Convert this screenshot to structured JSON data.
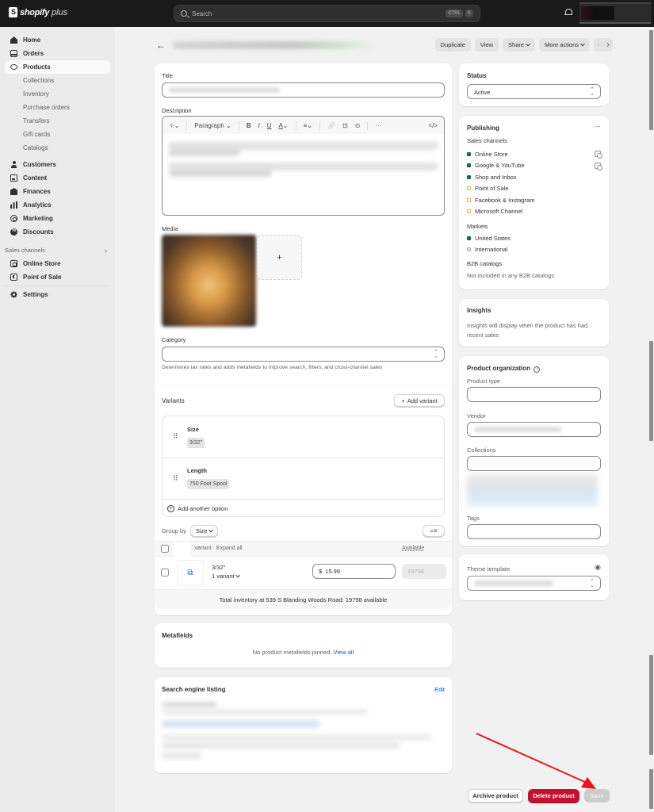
{
  "topbar": {
    "brand": "shopify",
    "brand_suffix": "plus",
    "search_placeholder": "Search",
    "shortcut_keys": [
      "CTRL",
      "K"
    ]
  },
  "sidebar": {
    "items": [
      {
        "label": "Home",
        "icon": "home-icon"
      },
      {
        "label": "Orders",
        "icon": "orders-icon"
      },
      {
        "label": "Products",
        "icon": "tag-icon",
        "active": true
      },
      {
        "label": "Collections",
        "sub": true
      },
      {
        "label": "Inventory",
        "sub": true
      },
      {
        "label": "Purchase orders",
        "sub": true
      },
      {
        "label": "Transfers",
        "sub": true
      },
      {
        "label": "Gift cards",
        "sub": true
      },
      {
        "label": "Catalogs",
        "sub": true
      },
      {
        "label": "Customers",
        "icon": "person-icon"
      },
      {
        "label": "Content",
        "icon": "content-icon"
      },
      {
        "label": "Finances",
        "icon": "bank-icon"
      },
      {
        "label": "Analytics",
        "icon": "chart-icon"
      },
      {
        "label": "Marketing",
        "icon": "marketing-icon"
      },
      {
        "label": "Discounts",
        "icon": "discount-icon"
      }
    ],
    "sales_channels_heading": "Sales channels",
    "channels": [
      {
        "label": "Online Store",
        "icon": "store-icon"
      },
      {
        "label": "Point of Sale",
        "icon": "pos-icon"
      }
    ],
    "settings_label": "Settings"
  },
  "header": {
    "buttons": {
      "duplicate": "Duplicate",
      "view": "View",
      "share": "Share",
      "more_actions": "More actions"
    }
  },
  "product": {
    "title_label": "Title",
    "description_label": "Description",
    "toolbar": {
      "format": "Paragraph"
    },
    "media_label": "Media",
    "category_label": "Category",
    "category_help": "Determines tax rates and adds metafields to improve search, filters, and cross-channel sales"
  },
  "variants": {
    "title": "Variants",
    "add_variant": "Add variant",
    "options": [
      {
        "name": "Size",
        "values": [
          "3/32\""
        ]
      },
      {
        "name": "Length",
        "values": [
          "750 Foot Spool"
        ]
      }
    ],
    "add_option": "Add another option",
    "group_by_label": "Group by",
    "group_by_value": "Size",
    "col_variant": "Variant · Expand all",
    "col_available": "Available",
    "rows": [
      {
        "name": "3/32\"",
        "count": "1 variant",
        "currency": "$",
        "price": "15.99",
        "available": "19798"
      }
    ],
    "total_inventory": "Total inventory at 539 S Blanding Woods Road: 19798 available"
  },
  "metafields": {
    "title": "Metafields",
    "empty_text": "No product metafields pinned.",
    "view_all": "View all"
  },
  "seo": {
    "title": "Search engine listing",
    "edit": "Edit"
  },
  "status": {
    "title": "Status",
    "value": "Active"
  },
  "publishing": {
    "title": "Publishing",
    "sales_channels_label": "Sales channels",
    "channels": [
      {
        "name": "Online Store",
        "state": "on",
        "scheduled_icon": true
      },
      {
        "name": "Google & YouTube",
        "state": "on",
        "scheduled_icon": true
      },
      {
        "name": "Shop and Inbox",
        "state": "on"
      },
      {
        "name": "Point of Sale",
        "state": "off"
      },
      {
        "name": "Facebook & Instagram",
        "state": "off"
      },
      {
        "name": "Microsoft Channel",
        "state": "off"
      }
    ],
    "markets_label": "Markets",
    "markets": [
      {
        "name": "United States",
        "state": "on"
      },
      {
        "name": "International",
        "state": "hollow"
      }
    ],
    "b2b_label": "B2B catalogs",
    "b2b_text": "Not included in any B2B catalogs"
  },
  "insights": {
    "title": "Insights",
    "text": "Insights will display when the product has had recent sales"
  },
  "organization": {
    "title": "Product organization",
    "product_type_label": "Product type",
    "vendor_label": "Vendor",
    "collections_label": "Collections",
    "tags_label": "Tags"
  },
  "theme": {
    "title": "Theme template"
  },
  "footer": {
    "archive": "Archive product",
    "delete": "Delete product",
    "save": "Save"
  },
  "colors": {
    "delete": "#c5102f",
    "link": "#005bd3",
    "published": "#1a6b4a",
    "annotation_arrow": "#e8141e"
  }
}
